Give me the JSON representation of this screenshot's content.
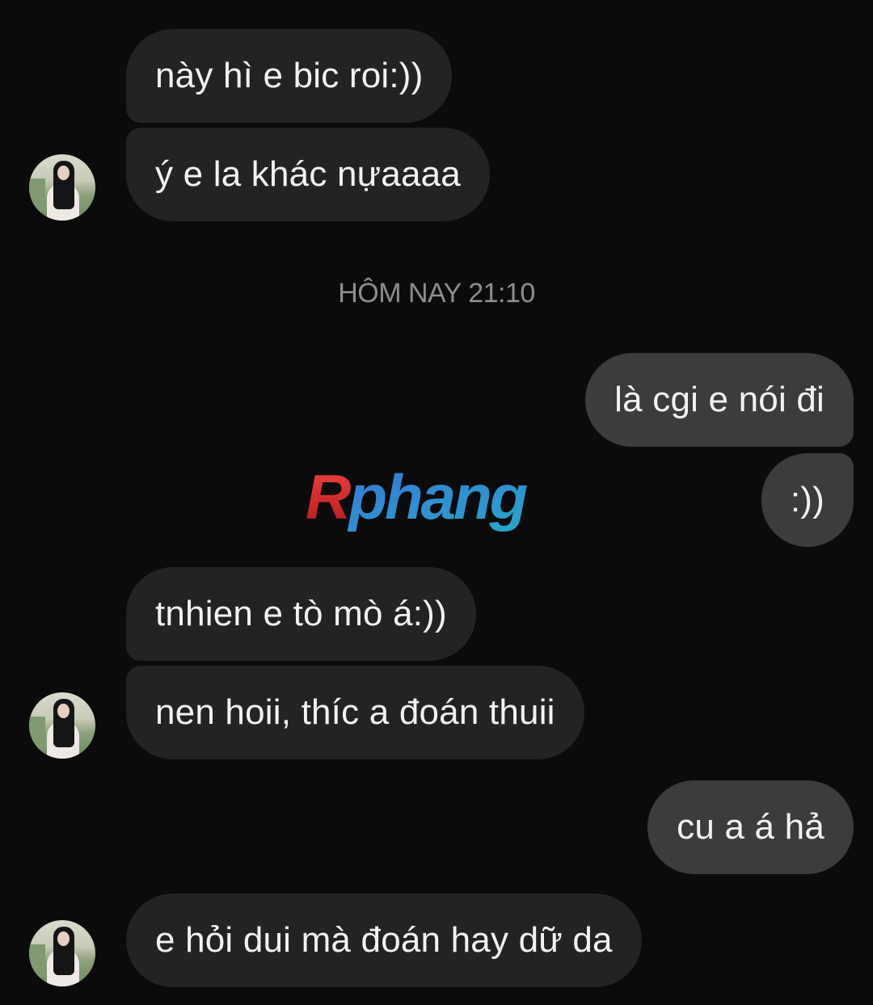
{
  "messages": {
    "m1": "này hì e bic roi:))",
    "m2": "ý e la khác nựaaaa",
    "m3": "là cgi e nói đi",
    "m4": ":))",
    "m5": "tnhien e tò mò á:))",
    "m6": "nen hoii, thíc a đoán thuii",
    "m7": "cu a á hả",
    "m8": "e hỏi dui mà đoán hay dữ da"
  },
  "divider": "HÔM NAY 21:10",
  "watermark": "Rphang",
  "colors": {
    "background": "#0b0b0c",
    "incoming_bubble": "#232325",
    "outgoing_bubble": "#3c3c3f",
    "timestamp": "#8d8d90",
    "watermark_red": "#d8262b",
    "watermark_blue": "#2f8fd6"
  }
}
